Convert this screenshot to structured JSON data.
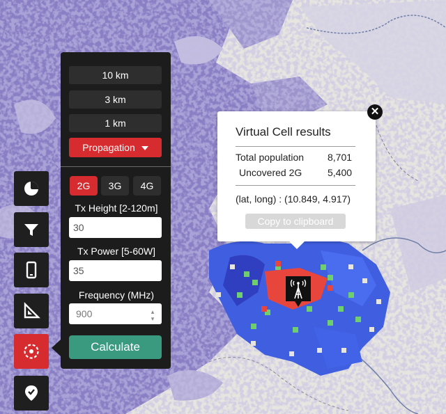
{
  "colors": {
    "panel": "#1c1c1c",
    "accent_red": "#d62b2f",
    "calculate_green": "#3a9a80",
    "coverage_blue": "#3f5fe0",
    "coverage_green": "#6fcf6f",
    "coverage_red": "#e8453c",
    "terrain_purple": "#8a7fc4"
  },
  "toolbar": {
    "items": [
      {
        "name": "statistics",
        "icon": "pie-chart-icon",
        "active": false
      },
      {
        "name": "filter",
        "icon": "filter-icon",
        "active": false
      },
      {
        "name": "device",
        "icon": "mobile-phone-icon",
        "active": false
      },
      {
        "name": "measure",
        "icon": "ruler-triangle-icon",
        "active": false
      },
      {
        "name": "virtual-cell",
        "icon": "target-icon",
        "active": true
      },
      {
        "name": "validate",
        "icon": "location-check-icon",
        "active": false
      }
    ]
  },
  "panel": {
    "radius_options": [
      "10 km",
      "3 km",
      "1 km"
    ],
    "propagation_label": "Propagation",
    "generations": [
      "2G",
      "3G",
      "4G"
    ],
    "active_generation": "2G",
    "tx_height_label": "Tx Height [2-120m]",
    "tx_height_value": "30",
    "tx_power_label": "Tx Power [5-60W]",
    "tx_power_value": "35",
    "frequency_label": "Frequency (MHz)",
    "frequency_value": "900",
    "calculate_label": "Calculate"
  },
  "results": {
    "title": "Virtual Cell results",
    "rows": [
      {
        "label": "Total population",
        "value": "8,701"
      },
      {
        "label": "Uncovered 2G",
        "value": "5,400"
      }
    ],
    "latlong": "(lat, long) : (10.849, 4.917)",
    "copy_label": "Copy to clipboard",
    "close_glyph": "✕"
  },
  "map": {
    "marker": "cell-tower-icon"
  }
}
